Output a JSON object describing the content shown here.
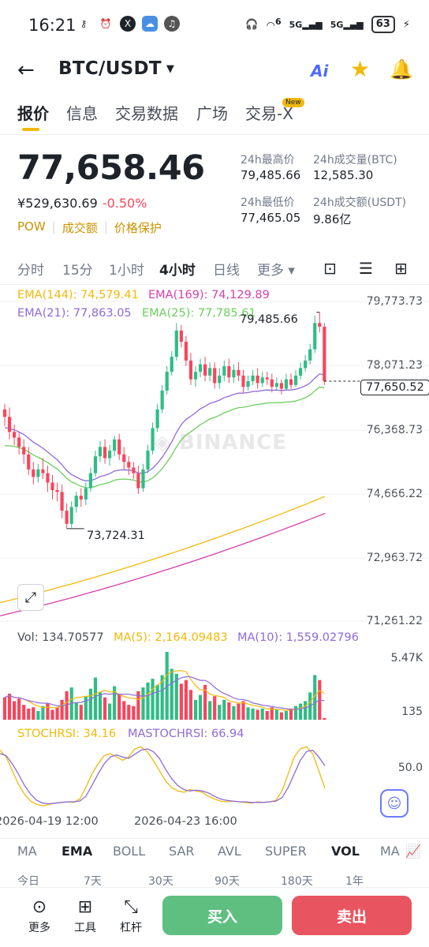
{
  "status": {
    "time": "16:21",
    "battery": "63",
    "net1": "5G",
    "net2": "5G",
    "wifi_tag": "6"
  },
  "nav": {
    "pair": "BTC/USDT",
    "ai": "Ai"
  },
  "tabs": [
    {
      "label": "报价"
    },
    {
      "label": "信息"
    },
    {
      "label": "交易数据"
    },
    {
      "label": "广场"
    },
    {
      "label": "交易-X"
    }
  ],
  "new_badge": "New",
  "price": {
    "last": "77,658.46",
    "cny": "¥529,630.69",
    "change": "-0.50%",
    "tags": [
      "POW",
      "成交额",
      "价格保护"
    ]
  },
  "stats": {
    "high_label": "24h最高价",
    "high": "79,485.66",
    "low_label": "24h最低价",
    "low": "77,465.05",
    "vol_btc_label": "24h成交量(BTC)",
    "vol_btc": "12,585.30",
    "vol_usdt_label": "24h成交额(USDT)",
    "vol_usdt": "9.86亿"
  },
  "intervals": [
    "分时",
    "15分",
    "1小时",
    "4小时",
    "日线",
    "更多"
  ],
  "indicators": {
    "ema144": "EMA(144): 74,579.41",
    "ema169": "EMA(169): 74,129.89",
    "ema21": "EMA(21): 77,863.05",
    "ema25": "EMA(25): 77,785.61",
    "vol": "Vol: 134.70577",
    "ma5": "MA(5): 2,164.09483",
    "ma10": "MA(10): 1,559.02796",
    "stochrsi": "STOCHRSI: 34.16",
    "mastochrsi": "MASTOCHRSI: 66.94"
  },
  "colors": {
    "up": "#2ebd85",
    "down": "#f6465d",
    "ema144": "#f0b90b",
    "ema169": "#d63fa8",
    "ema21": "#8f6ad9",
    "ema25": "#6ccf5e",
    "accent": "#f0b90b"
  },
  "axis": {
    "price_ticks": [
      "79,773.73",
      "78,071.23",
      "76,368.73",
      "74,666.22",
      "72,963.72",
      "71,261.22"
    ],
    "vol_ticks": [
      "5.47K",
      "135"
    ],
    "rsi_ticks": [
      "50.0"
    ],
    "high_mark": "79,485.66",
    "low_mark": "73,724.31",
    "current": "77,650.52",
    "dates": [
      "2026-04-19 12:00",
      "2026-04-23 16:00"
    ]
  },
  "watermark": "BINANCE",
  "bottom_tabs": [
    "MA",
    "EMA",
    "BOLL",
    "SAR",
    "AVL",
    "SUPER",
    "VOL",
    "MA"
  ],
  "range_row": [
    "今日",
    "7天",
    "30天",
    "90天",
    "180天",
    "1年"
  ],
  "footer": {
    "more": "更多",
    "tools": "工具",
    "leverage": "杠杆",
    "buy": "买入",
    "sell": "卖出"
  },
  "chart_data": {
    "type": "candlestick",
    "ylim": [
      71261.22,
      79773.73
    ],
    "candles": [
      [
        76900,
        76700,
        77050,
        76450
      ],
      [
        76700,
        76300,
        76950,
        76100
      ],
      [
        76300,
        76150,
        76500,
        75950
      ],
      [
        76150,
        75900,
        76300,
        75700
      ],
      [
        75900,
        75700,
        76100,
        75450
      ],
      [
        75700,
        75300,
        75900,
        75150
      ],
      [
        75300,
        75100,
        75500,
        74900
      ],
      [
        75100,
        75300,
        75450,
        74950
      ],
      [
        75300,
        75200,
        75600,
        75050
      ],
      [
        75200,
        74950,
        75400,
        74700
      ],
      [
        74950,
        74750,
        75150,
        74500
      ],
      [
        74750,
        74700,
        74950,
        74450
      ],
      [
        74700,
        74200,
        74900,
        74000
      ],
      [
        74200,
        73850,
        74400,
        73724
      ],
      [
        73850,
        74300,
        74450,
        73750
      ],
      [
        74300,
        74600,
        74700,
        74150
      ],
      [
        74600,
        74500,
        74800,
        74300
      ],
      [
        74500,
        74800,
        74950,
        74350
      ],
      [
        74800,
        75200,
        75350,
        74700
      ],
      [
        75200,
        75650,
        75800,
        75100
      ],
      [
        75650,
        75900,
        76050,
        75500
      ],
      [
        75900,
        75600,
        76100,
        75450
      ],
      [
        75600,
        75800,
        75950,
        75400
      ],
      [
        75800,
        76100,
        76200,
        75650
      ],
      [
        76100,
        75700,
        76250,
        75550
      ],
      [
        75700,
        75500,
        75900,
        75300
      ],
      [
        75500,
        75350,
        75650,
        75150
      ],
      [
        75350,
        75200,
        75500,
        75050
      ],
      [
        75200,
        74800,
        75400,
        74650
      ],
      [
        74800,
        75300,
        75450,
        74700
      ],
      [
        75300,
        75800,
        75950,
        75200
      ],
      [
        75800,
        76400,
        76550,
        75700
      ],
      [
        76400,
        76900,
        77050,
        76300
      ],
      [
        76900,
        77400,
        77550,
        76800
      ],
      [
        77400,
        77900,
        78050,
        77300
      ],
      [
        77900,
        78300,
        78450,
        77800
      ],
      [
        78300,
        79000,
        79200,
        78200
      ],
      [
        79000,
        78700,
        79150,
        78550
      ],
      [
        78700,
        78200,
        78850,
        78050
      ],
      [
        78200,
        77700,
        78400,
        77550
      ],
      [
        77700,
        77900,
        78050,
        77500
      ],
      [
        77900,
        78100,
        78250,
        77750
      ],
      [
        78100,
        77800,
        78300,
        77650
      ],
      [
        77800,
        78000,
        78150,
        77650
      ],
      [
        78000,
        77600,
        78150,
        77450
      ],
      [
        77600,
        77800,
        78000,
        77450
      ],
      [
        77800,
        78050,
        78200,
        77650
      ],
      [
        78050,
        77750,
        78250,
        77600
      ],
      [
        77750,
        77950,
        78100,
        77600
      ],
      [
        77950,
        77800,
        78150,
        77650
      ],
      [
        77800,
        77500,
        77950,
        77350
      ],
      [
        77500,
        77650,
        77800,
        77400
      ],
      [
        77650,
        77800,
        77950,
        77550
      ],
      [
        77800,
        77600,
        78000,
        77450
      ],
      [
        77600,
        77750,
        77900,
        77500
      ],
      [
        77750,
        77700,
        77900,
        77550
      ],
      [
        77700,
        77500,
        77850,
        77350
      ],
      [
        77500,
        77600,
        77750,
        77400
      ],
      [
        77600,
        77450,
        77700,
        77300
      ],
      [
        77450,
        77700,
        77850,
        77400
      ],
      [
        77700,
        77550,
        77850,
        77450
      ],
      [
        77550,
        77800,
        77950,
        77500
      ],
      [
        77800,
        78000,
        78150,
        77700
      ],
      [
        78000,
        78200,
        78350,
        77900
      ],
      [
        78200,
        78500,
        78650,
        78100
      ],
      [
        78500,
        79200,
        79400,
        78400
      ],
      [
        79200,
        79100,
        79485,
        78950
      ],
      [
        79100,
        77650,
        79200,
        77550
      ]
    ],
    "volumes": [
      [
        1800,
        "d"
      ],
      [
        2100,
        "d"
      ],
      [
        1500,
        "d"
      ],
      [
        1700,
        "d"
      ],
      [
        1200,
        "d"
      ],
      [
        900,
        "d"
      ],
      [
        1000,
        "d"
      ],
      [
        700,
        "u"
      ],
      [
        1100,
        "u"
      ],
      [
        1300,
        "d"
      ],
      [
        800,
        "d"
      ],
      [
        1000,
        "d"
      ],
      [
        1600,
        "d"
      ],
      [
        2300,
        "d"
      ],
      [
        2600,
        "u"
      ],
      [
        1400,
        "u"
      ],
      [
        1200,
        "d"
      ],
      [
        1900,
        "u"
      ],
      [
        2500,
        "u"
      ],
      [
        3400,
        "u"
      ],
      [
        2200,
        "u"
      ],
      [
        1800,
        "d"
      ],
      [
        1300,
        "u"
      ],
      [
        2700,
        "u"
      ],
      [
        2100,
        "d"
      ],
      [
        1500,
        "d"
      ],
      [
        1200,
        "d"
      ],
      [
        1100,
        "d"
      ],
      [
        2300,
        "d"
      ],
      [
        2600,
        "u"
      ],
      [
        3000,
        "u"
      ],
      [
        3300,
        "u"
      ],
      [
        2800,
        "u"
      ],
      [
        3600,
        "u"
      ],
      [
        5470,
        "u"
      ],
      [
        4100,
        "u"
      ],
      [
        3700,
        "u"
      ],
      [
        2900,
        "d"
      ],
      [
        3200,
        "d"
      ],
      [
        2400,
        "d"
      ],
      [
        1600,
        "u"
      ],
      [
        2000,
        "u"
      ],
      [
        2800,
        "d"
      ],
      [
        1500,
        "u"
      ],
      [
        1900,
        "d"
      ],
      [
        1200,
        "u"
      ],
      [
        1600,
        "u"
      ],
      [
        1400,
        "d"
      ],
      [
        1100,
        "u"
      ],
      [
        1300,
        "d"
      ],
      [
        1500,
        "d"
      ],
      [
        1000,
        "u"
      ],
      [
        900,
        "u"
      ],
      [
        800,
        "d"
      ],
      [
        900,
        "u"
      ],
      [
        700,
        "d"
      ],
      [
        1000,
        "d"
      ],
      [
        800,
        "u"
      ],
      [
        600,
        "d"
      ],
      [
        700,
        "u"
      ],
      [
        900,
        "d"
      ],
      [
        1100,
        "u"
      ],
      [
        1300,
        "u"
      ],
      [
        1500,
        "u"
      ],
      [
        2200,
        "u"
      ],
      [
        3600,
        "u"
      ],
      [
        3200,
        "d"
      ],
      [
        135,
        "d"
      ]
    ],
    "stochrsi": [
      90,
      80,
      60,
      40,
      25,
      15,
      10,
      8,
      10,
      12,
      13,
      14,
      13,
      18,
      35,
      55,
      70,
      82,
      85,
      80,
      75,
      80,
      92,
      95,
      88,
      75,
      60,
      45,
      35,
      30,
      28,
      32,
      30,
      28,
      22,
      18,
      15,
      14,
      15,
      14,
      13,
      12,
      14,
      13,
      14,
      16,
      30,
      55,
      80,
      92,
      95,
      85,
      60,
      34
    ],
    "mastochrsi": [
      85,
      82,
      70,
      55,
      38,
      25,
      16,
      12,
      11,
      12,
      13,
      14,
      14,
      15,
      22,
      38,
      55,
      70,
      80,
      83,
      80,
      78,
      84,
      90,
      92,
      88,
      78,
      62,
      48,
      38,
      32,
      30,
      31,
      30,
      27,
      22,
      18,
      16,
      15,
      14,
      14,
      13,
      13,
      13,
      14,
      15,
      20,
      35,
      55,
      75,
      88,
      90,
      80,
      67
    ]
  }
}
